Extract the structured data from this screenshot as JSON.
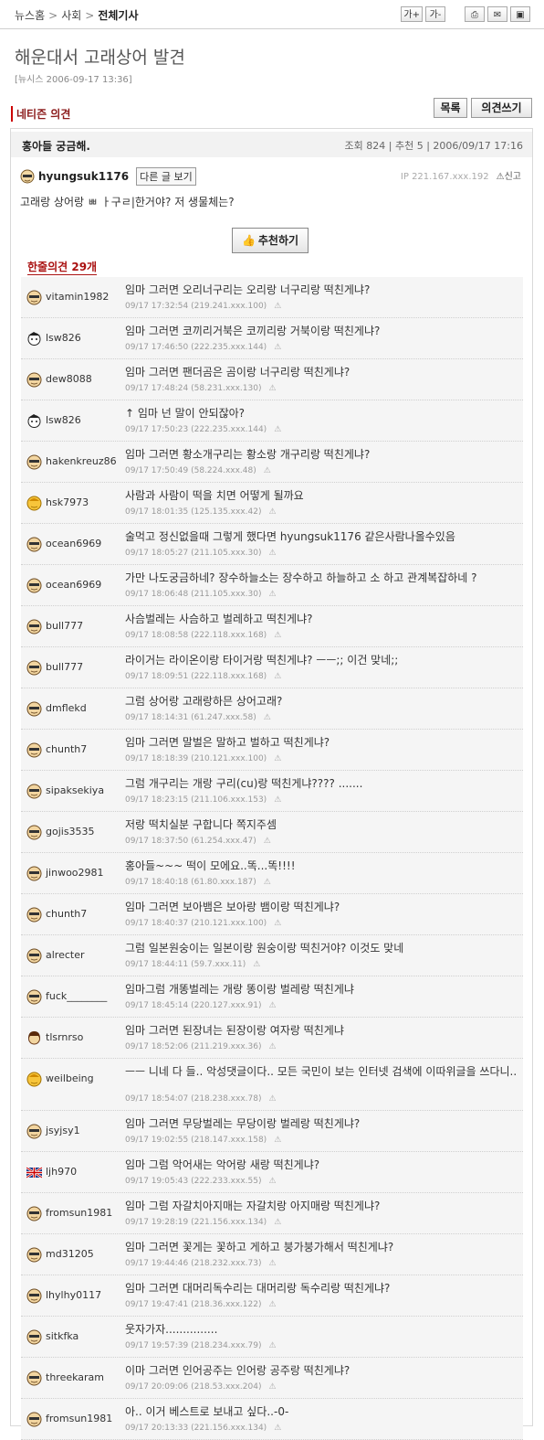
{
  "breadcrumb": {
    "home": "뉴스홈",
    "section": "사회",
    "current": "전체기사"
  },
  "toolbar": {
    "font_up": "가+",
    "font_down": "가-",
    "print": "⎙",
    "mail": "✉",
    "save": "▣"
  },
  "article": {
    "title": "해운대서 고래상어 발견",
    "source": "[뉴시스 2006-09-17 13:36]"
  },
  "netizen": {
    "heading": "네티즌 의견",
    "list_btn": "목록",
    "write_btn": "의견쓰기"
  },
  "post": {
    "title": "홍아들 궁금해.",
    "meta": "조회 824 | 추천 5 | 2006/09/17 17:16",
    "author": "hyungsuk1176",
    "other_posts_btn": "다른 글 보기",
    "ip": "IP 221.167.xxx.192",
    "report": "신고",
    "body": "고래랑 상어랑 ㅃ ㅏ구ㄹ|한거야? 저 생물체는?",
    "recommend_btn": "추천하기"
  },
  "comments_title": "한줄의견 29개",
  "comments": [
    {
      "user": "vitamin1982",
      "text": "임마 그러면 오리너구리는 오리랑 너구리랑 떡친게냐?",
      "meta": "09/17 17:32:54 (219.241.xxx.100)"
    },
    {
      "user": "lsw826",
      "text": "임마 그러면 코끼리거북은 코끼리랑 거북이랑 떡친게냐?",
      "meta": "09/17 17:46:50 (222.235.xxx.144)"
    },
    {
      "user": "dew8088",
      "text": "임마 그러면 팬더곰은 곰이랑 너구리랑 떡친게냐?",
      "meta": "09/17 17:48:24 (58.231.xxx.130)"
    },
    {
      "user": "lsw826",
      "text": "↑ 임마 넌 말이 안되잖아?",
      "meta": "09/17 17:50:23 (222.235.xxx.144)"
    },
    {
      "user": "hakenkreuz86",
      "text": "임마 그러면 황소개구리는 황소랑 개구리랑 떡친게냐?",
      "meta": "09/17 17:50:49 (58.224.xxx.48)"
    },
    {
      "user": "hsk7973",
      "text": "사람과 사람이 떡을 치면 어떻게 될까요",
      "meta": "09/17 18:01:35 (125.135.xxx.42)"
    },
    {
      "user": "ocean6969",
      "text": "술먹고 정신없을때 그렇게 했다면 hyungsuk1176 같은사람나올수있음",
      "meta": "09/17 18:05:27 (211.105.xxx.30)"
    },
    {
      "user": "ocean6969",
      "text": "가만 나도궁금하네? 장수하늘소는 장수하고 하늘하고 소 하고 관계복잡하네 ?",
      "meta": "09/17 18:06:48 (211.105.xxx.30)"
    },
    {
      "user": "bull777",
      "text": "사슴벌레는 사슴하고 벌레하고 떡친게냐?",
      "meta": "09/17 18:08:58 (222.118.xxx.168)"
    },
    {
      "user": "bull777",
      "text": "라이거는 라이온이랑 타이거랑 떡친게냐? ㅡㅡ;; 이건 맞네;;",
      "meta": "09/17 18:09:51 (222.118.xxx.168)"
    },
    {
      "user": "dmflekd",
      "text": "그럼 상어랑 고래랑하믄 상어고래?",
      "meta": "09/17 18:14:31 (61.247.xxx.58)"
    },
    {
      "user": "chunth7",
      "text": "임마 그러면 말벌은 말하고 벌하고 떡친게냐?",
      "meta": "09/17 18:18:39 (210.121.xxx.100)"
    },
    {
      "user": "sipaksekiya",
      "text": "그럼 개구리는 개랑 구리(cu)랑 떡친게냐???? .......",
      "meta": "09/17 18:23:15 (211.106.xxx.153)"
    },
    {
      "user": "gojis3535",
      "text": "저랑 떡치실분 구합니다 쪽지주셈",
      "meta": "09/17 18:37:50 (61.254.xxx.47)"
    },
    {
      "user": "jinwoo2981",
      "text": "홍아들~~~ 떡이 모에요..똑...똑!!!!",
      "meta": "09/17 18:40:18 (61.80.xxx.187)"
    },
    {
      "user": "chunth7",
      "text": "임마 그러면 보아뱀은 보아랑 뱀이랑 떡친게냐?",
      "meta": "09/17 18:40:37 (210.121.xxx.100)"
    },
    {
      "user": "alrecter",
      "text": "그럼 일본원숭이는 일본이랑 원숭이랑 떡친거야? 이것도 맞네",
      "meta": "09/17 18:44:11 (59.7.xxx.11)"
    },
    {
      "user": "fuck________",
      "text": "임마그럼 개똥벌레는 개랑 똥이랑 벌레랑 떡친게냐",
      "meta": "09/17 18:45:14 (220.127.xxx.91)"
    },
    {
      "user": "tlsrnrso",
      "text": "임마 그러면 된장녀는 된장이랑 여자랑 떡친게냐",
      "meta": "09/17 18:52:06 (211.219.xxx.36)"
    },
    {
      "user": "weilbeing",
      "text": "ㅡㅡ 니네 다 들.. 악성댓글이다.. 모든 국민이 보는 인터넷 검색에 이따위글을 쓰다니..",
      "meta": "09/17 18:54:07 (218.238.xxx.78)"
    },
    {
      "user": "jsyjsy1",
      "text": "임마 그러면 무당벌레는 무당이랑 벌레랑 떡친게냐?",
      "meta": "09/17 19:02:55 (218.147.xxx.158)"
    },
    {
      "user": "ljh970",
      "text": "임마 그럼 악어새는 악어랑 새랑 떡친게냐?",
      "meta": "09/17 19:05:43 (222.233.xxx.55)"
    },
    {
      "user": "fromsun1981",
      "text": "임마 그럼 자갈치아지매는 자갈치랑 아지매랑 떡친게냐?",
      "meta": "09/17 19:28:19 (221.156.xxx.134)"
    },
    {
      "user": "md31205",
      "text": "임마 그러면 꽃게는 꽃하고 게하고 붕가붕가해서 떡친게냐?",
      "meta": "09/17 19:44:46 (218.232.xxx.73)"
    },
    {
      "user": "lhylhy0117",
      "text": "임마 그러면 대머리독수리는 대머리랑 독수리랑 떡친게냐?",
      "meta": "09/17 19:47:41 (218.36.xxx.122)"
    },
    {
      "user": "sitkfka",
      "text": "웃자가자...............",
      "meta": "09/17 19:57:39 (218.234.xxx.79)"
    },
    {
      "user": "threekaram",
      "text": "이마 그러면 인어공주는 인어랑 공주랑 떡친게냐?",
      "meta": "09/17 20:09:06 (218.53.xxx.204)"
    },
    {
      "user": "fromsun1981",
      "text": "아.. 이거 베스트로 보내고 싶다..-0-",
      "meta": "09/17 20:13:33 (221.156.xxx.134)"
    }
  ]
}
